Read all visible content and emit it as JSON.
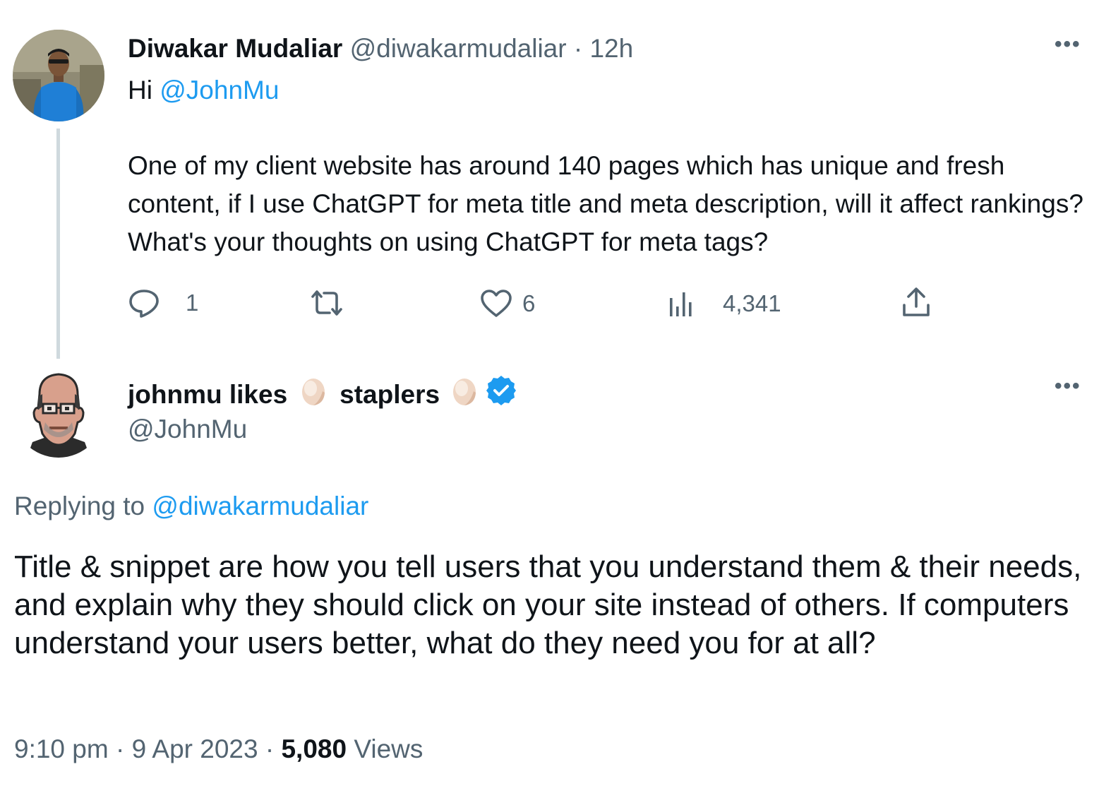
{
  "original_tweet": {
    "author_name": "Diwakar Mudaliar",
    "author_handle": "@diwakarmudaliar",
    "separator": "·",
    "time_ago": "12h",
    "greeting_prefix": "Hi",
    "mention": "@JohnMu",
    "body": "One of my client website has around 140 pages which has unique and fresh content, if I use ChatGPT for meta title and meta description, will it affect rankings? What's your thoughts on using ChatGPT for meta tags?",
    "actions": {
      "reply_count": "1",
      "retweet_count": "",
      "like_count": "6",
      "view_count": "4,341"
    },
    "icons": [
      "reply-icon",
      "retweet-icon",
      "like-icon",
      "views-icon",
      "share-icon",
      "more-icon"
    ]
  },
  "reply_tweet": {
    "author_name_part1": "johnmu likes",
    "author_name_part2": "staplers",
    "author_handle": "@JohnMu",
    "replying_to_label": "Replying to",
    "replying_to_handle": "@diwakarmudaliar",
    "body": "Title & snippet are how you tell users that you understand them & their needs, and explain why they should click on your site instead of others. If computers understand your users better, what do they need you for at all?",
    "timestamp_time": "9:10 pm",
    "separator1": "·",
    "timestamp_date": "9 Apr 2023",
    "separator2": "·",
    "view_count": "5,080",
    "views_label": "Views",
    "icons": [
      "egg-icon",
      "verified-badge-icon",
      "more-icon"
    ]
  },
  "colors": {
    "link": "#1d9bf0",
    "muted": "#536471",
    "text": "#0f1419",
    "thread_line": "#cfd9de",
    "verified": "#1d9bf0"
  }
}
